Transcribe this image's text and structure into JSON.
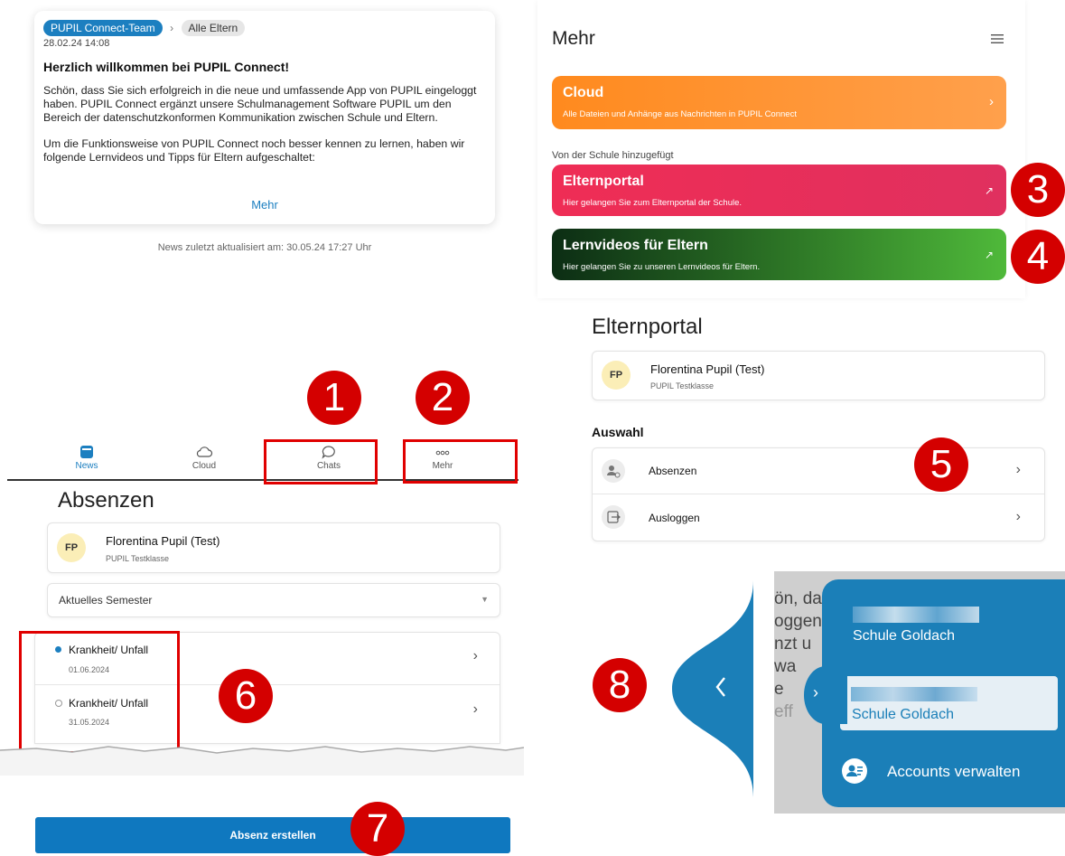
{
  "news": {
    "sender_chip": "PUPIL Connect-Team",
    "recipient_chip": "Alle Eltern",
    "date": "28.02.24 14:08",
    "title": "Herzlich willkommen bei PUPIL Connect!",
    "para1_lines": [
      "Schön, dass Sie sich erfolgreich in die neue und umfassende App von PUPIL eingeloggt",
      "haben. PUPIL Connect ergänzt unsere Schulmanagement Software PUPIL um den",
      "Bereich der datenschutzkonformen Kommunikation zwischen Schule und Eltern."
    ],
    "para2_lines": [
      "Um die Funktionsweise von PUPIL Connect noch besser kennen zu lernen, haben wir",
      "folgende Lernvideos und Tipps für Eltern aufgeschaltet:"
    ],
    "more_link": "Mehr",
    "updated": "News zuletzt aktualisiert am: 30.05.24 17:27 Uhr"
  },
  "nav": {
    "items": [
      {
        "label": "News",
        "icon": "news-icon"
      },
      {
        "label": "Cloud",
        "icon": "cloud-icon"
      },
      {
        "label": "Chats",
        "icon": "chat-bubble-icon"
      },
      {
        "label": "Mehr",
        "icon": "more-dots-icon"
      }
    ],
    "active_color": "#1c7fc0"
  },
  "badges": [
    "1",
    "2",
    "3",
    "4",
    "5",
    "6",
    "7",
    "8"
  ],
  "absenzen": {
    "title": "Absenzen",
    "student_initials": "FP",
    "student_name": "Florentina Pupil (Test)",
    "student_class": "PUPIL Testklasse",
    "semester_select": "Aktuelles Semester",
    "entries": [
      {
        "reason": "Krankheit/ Unfall",
        "date": "01.06.2024"
      },
      {
        "reason": "Krankheit/ Unfall",
        "date": "31.05.2024"
      }
    ],
    "create_button": "Absenz erstellen"
  },
  "mehr": {
    "title": "Mehr",
    "cloud_tile": {
      "title": "Cloud",
      "subtitle": "Alle Dateien und Anhänge aus Nachrichten in PUPIL Connect"
    },
    "school_section": "Von der Schule hinzugefügt",
    "elternportal_tile": {
      "title": "Elternportal",
      "subtitle": "Hier gelangen Sie zum Elternportal der Schule."
    },
    "lernvideos_tile": {
      "title": "Lernvideos für Eltern",
      "subtitle": "Hier gelangen Sie zu unseren Lernvideos für Eltern."
    }
  },
  "elternportal": {
    "title": "Elternportal",
    "student_initials": "FP",
    "student_name": "Florentina Pupil (Test)",
    "student_class": "PUPIL Testklasse",
    "selection_label": "Auswahl",
    "options": [
      "Absenzen",
      "Ausloggen"
    ]
  },
  "switcher": {
    "bg_fragments": [
      "ön, das",
      "oggen",
      "nzt u",
      "wa",
      "e",
      "eff"
    ],
    "accounts": [
      "Schule Goldach",
      "Schule Goldach"
    ],
    "manage_label": "Accounts verwalten"
  },
  "colors": {
    "brand_blue": "#1c7fc0",
    "badge_red": "#d40000",
    "cloud_orange": "#ff8a1e",
    "elternportal_red": "#e8264f",
    "lernvideos_green": "#3fae35"
  }
}
